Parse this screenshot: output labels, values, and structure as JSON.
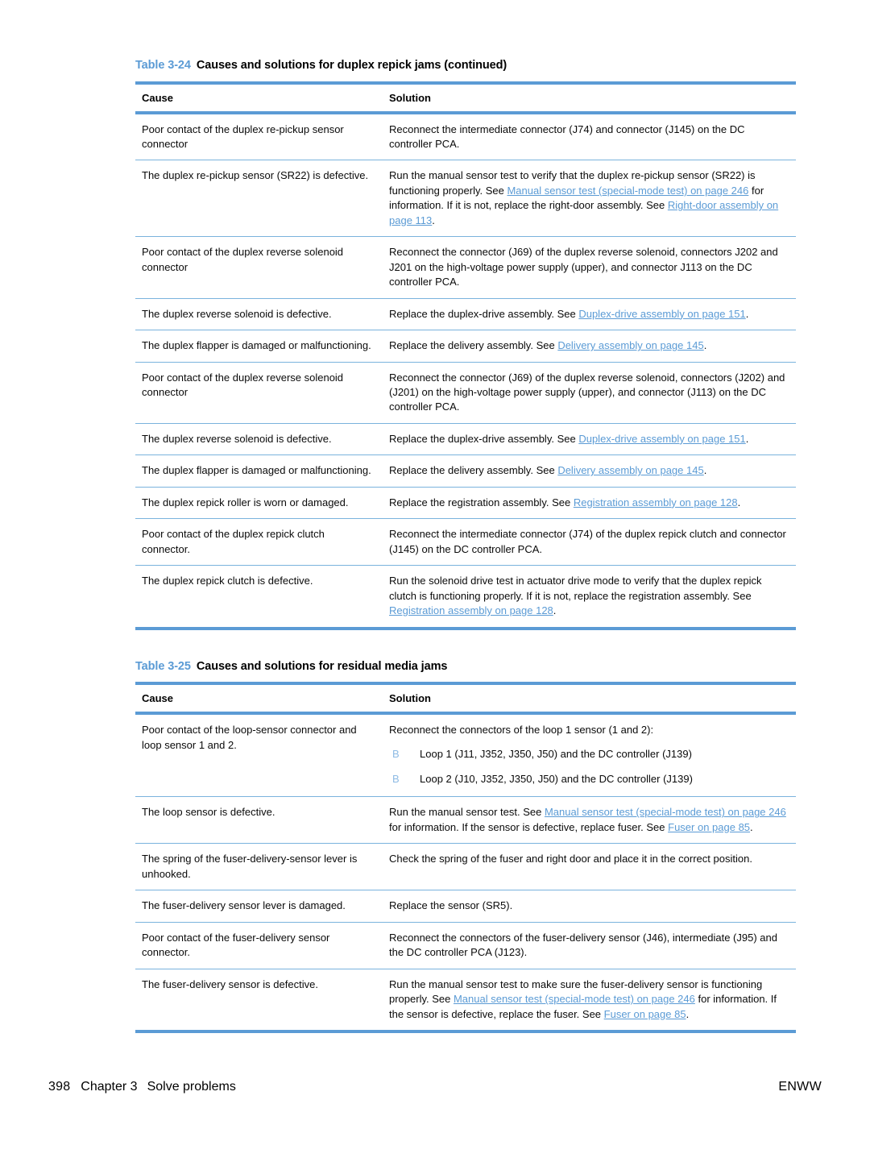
{
  "colors": {
    "accent_blue": "#5b9bd5",
    "rule_light_blue": "#7ab3dd",
    "link_blue": "#5b9bd5",
    "bullet_blue": "#8ebbe4",
    "text": "#0a0a0a"
  },
  "table1": {
    "number": "Table 3-24",
    "title": "Causes and solutions for duplex repick jams (continued)",
    "columns": [
      "Cause",
      "Solution"
    ],
    "rows": [
      {
        "cause": "Poor contact of the duplex re-pickup sensor connector",
        "solution_parts": [
          {
            "text": "Reconnect the intermediate connector (J74) and connector (J145) on the DC controller PCA.",
            "link": false
          }
        ]
      },
      {
        "cause": "The duplex re-pickup sensor (SR22) is defective.",
        "solution_parts": [
          {
            "text": "Run the manual sensor test to verify that the duplex re-pickup sensor (SR22) is functioning properly. See ",
            "link": false
          },
          {
            "text": "Manual sensor test (special-mode test) on page 246",
            "link": true
          },
          {
            "text": " for information. If it is not, replace the right-door assembly. See ",
            "link": false
          },
          {
            "text": "Right-door assembly on page 113",
            "link": true
          },
          {
            "text": ".",
            "link": false
          }
        ]
      },
      {
        "cause": "Poor contact of the duplex reverse solenoid connector",
        "solution_parts": [
          {
            "text": "Reconnect the connector (J69) of the duplex reverse solenoid, connectors J202 and J201 on the high-voltage power supply (upper), and connector J113 on the DC controller PCA.",
            "link": false
          }
        ]
      },
      {
        "cause": "The duplex reverse solenoid is defective.",
        "solution_parts": [
          {
            "text": "Replace the duplex-drive assembly. See ",
            "link": false
          },
          {
            "text": "Duplex-drive assembly on page 151",
            "link": true
          },
          {
            "text": ".",
            "link": false
          }
        ]
      },
      {
        "cause": "The duplex flapper is damaged or malfunctioning.",
        "solution_parts": [
          {
            "text": "Replace the delivery assembly. See ",
            "link": false
          },
          {
            "text": "Delivery assembly on page 145",
            "link": true
          },
          {
            "text": ".",
            "link": false
          }
        ]
      },
      {
        "cause": "Poor contact of the duplex reverse solenoid connector",
        "solution_parts": [
          {
            "text": "Reconnect the connector (J69) of the duplex reverse solenoid, connectors (J202) and (J201) on the high-voltage power supply (upper), and connector (J113) on the DC controller PCA.",
            "link": false
          }
        ]
      },
      {
        "cause": "The duplex reverse solenoid is defective.",
        "solution_parts": [
          {
            "text": "Replace the duplex-drive assembly. See ",
            "link": false
          },
          {
            "text": "Duplex-drive assembly on page 151",
            "link": true
          },
          {
            "text": ".",
            "link": false
          }
        ]
      },
      {
        "cause": "The duplex flapper is damaged or malfunctioning.",
        "solution_parts": [
          {
            "text": "Replace the delivery assembly. See ",
            "link": false
          },
          {
            "text": "Delivery assembly on page 145",
            "link": true
          },
          {
            "text": ".",
            "link": false
          }
        ]
      },
      {
        "cause": "The duplex repick roller is worn or damaged.",
        "solution_parts": [
          {
            "text": "Replace the registration assembly. See ",
            "link": false
          },
          {
            "text": "Registration assembly on page 128",
            "link": true
          },
          {
            "text": ".",
            "link": false
          }
        ]
      },
      {
        "cause": "Poor contact of the duplex repick clutch connector.",
        "solution_parts": [
          {
            "text": "Reconnect the intermediate connector (J74) of the duplex repick clutch and connector (J145) on the DC controller PCA.",
            "link": false
          }
        ]
      },
      {
        "cause": "The duplex repick clutch is defective.",
        "solution_parts": [
          {
            "text": "Run the solenoid drive test in actuator drive mode to verify that the duplex repick clutch is functioning properly. If it is not, replace the registration assembly. See ",
            "link": false
          },
          {
            "text": "Registration assembly on page 128",
            "link": true
          },
          {
            "text": ".",
            "link": false
          }
        ]
      }
    ]
  },
  "table2": {
    "number": "Table 3-25",
    "title": "Causes and solutions for residual media jams",
    "columns": [
      "Cause",
      "Solution"
    ],
    "rows": [
      {
        "cause": "Poor contact of the loop-sensor connector and loop sensor 1 and 2.",
        "solution_parts": [
          {
            "text": "Reconnect the connectors of the loop 1 sensor (1 and 2):",
            "link": false
          }
        ],
        "bullets": [
          {
            "marker": "B",
            "text": "Loop 1 (J11, J352, J350, J50) and the DC controller (J139)"
          },
          {
            "marker": "B",
            "text": "Loop 2 (J10, J352, J350, J50) and the DC controller (J139)"
          }
        ]
      },
      {
        "cause": "The loop sensor is defective.",
        "solution_parts": [
          {
            "text": "Run the manual sensor test. See ",
            "link": false
          },
          {
            "text": "Manual sensor test (special-mode test) on page 246",
            "link": true
          },
          {
            "text": " for information. If the sensor is defective, replace fuser. See ",
            "link": false
          },
          {
            "text": "Fuser  on page 85",
            "link": true
          },
          {
            "text": ".",
            "link": false
          }
        ]
      },
      {
        "cause": "The spring of the fuser-delivery-sensor lever is unhooked.",
        "solution_parts": [
          {
            "text": "Check the spring of the fuser and right door and place it in the correct position.",
            "link": false
          }
        ]
      },
      {
        "cause": "The fuser-delivery sensor lever is damaged.",
        "solution_parts": [
          {
            "text": "Replace the sensor (SR5).",
            "link": false
          }
        ]
      },
      {
        "cause": "Poor contact of the fuser-delivery sensor connector.",
        "solution_parts": [
          {
            "text": "Reconnect the connectors of the fuser-delivery sensor (J46), intermediate (J95) and the DC controller PCA (J123).",
            "link": false
          }
        ]
      },
      {
        "cause": "The fuser-delivery sensor is defective.",
        "solution_parts": [
          {
            "text": "Run the manual sensor test to make sure the fuser-delivery sensor is functioning properly. See ",
            "link": false
          },
          {
            "text": "Manual sensor test (special-mode test) on page 246",
            "link": true
          },
          {
            "text": " for information. If the sensor is defective, replace the fuser. See ",
            "link": false
          },
          {
            "text": "Fuser  on page 85",
            "link": true
          },
          {
            "text": ".",
            "link": false
          }
        ]
      }
    ]
  },
  "footer": {
    "page_number": "398",
    "chapter": "Chapter 3",
    "section": "Solve problems",
    "right_label": "ENWW"
  }
}
